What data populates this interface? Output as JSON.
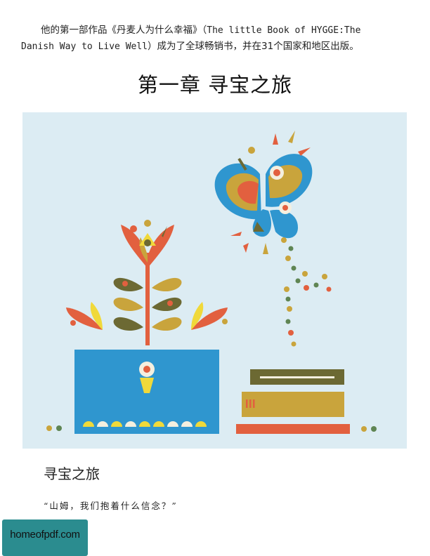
{
  "intro": {
    "line1_cn": "他的第一部作品《丹麦人为什么幸福》（",
    "line1_en": "The little Book of HYGGE:The",
    "line2_en": "Danish Way to Live Well",
    "line2_cn": "）成为了全球畅销书，并在31个国家和地区出版。"
  },
  "chapter_title": "第一章  寻宝之旅",
  "illustration": {
    "colors": {
      "background": "#dcecf3",
      "blue": "#2f96cf",
      "red": "#e2603f",
      "olive": "#6c6933",
      "mustard": "#c9a43c",
      "yellow": "#f0d93a",
      "green": "#5f8553",
      "cream": "#f4efdf"
    },
    "icons": [
      "butterfly-icon",
      "tulip-plant-icon",
      "treasure-box-icon",
      "keyhole-icon",
      "book-stack-icon"
    ]
  },
  "section_title": "寻宝之旅",
  "quote": "“山姆，我们抱着什么信念？”",
  "watermark": "homeofpdf.com"
}
